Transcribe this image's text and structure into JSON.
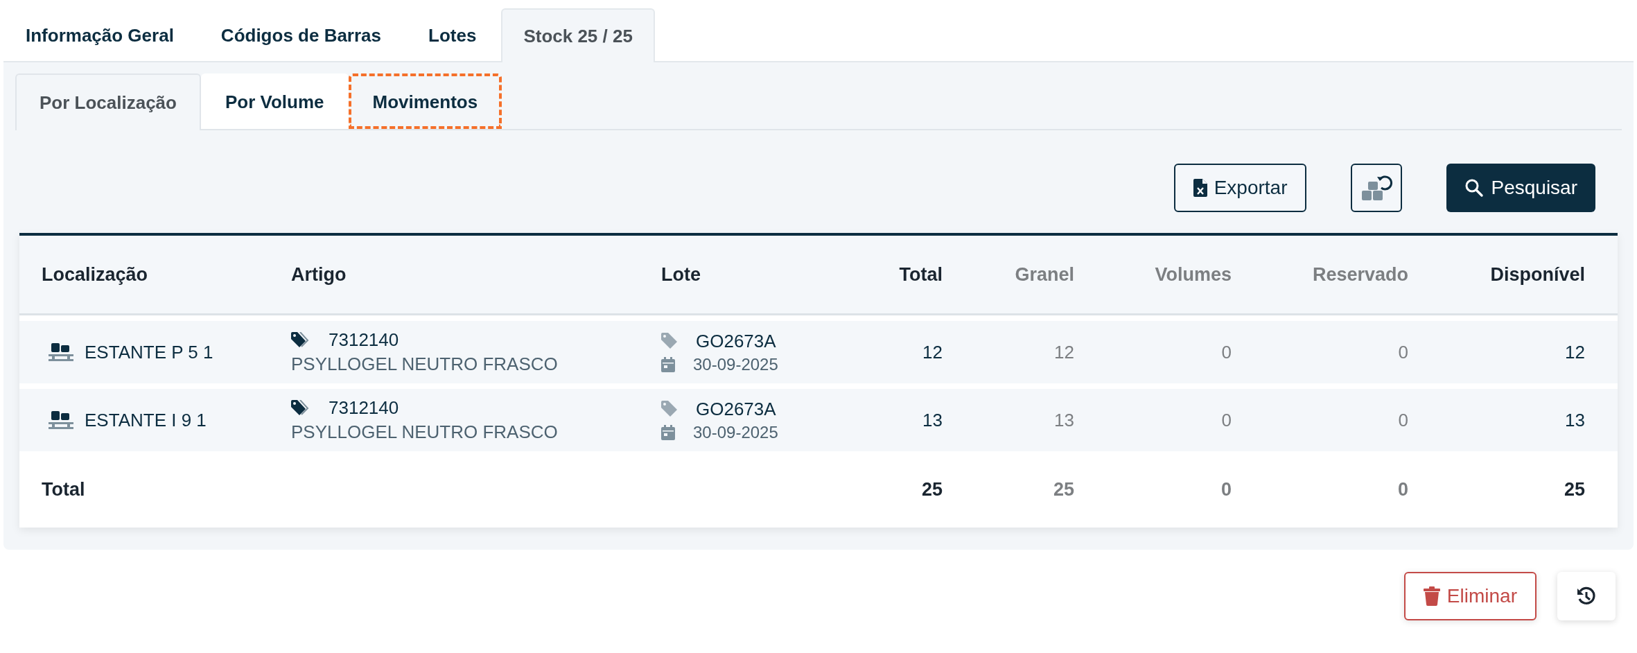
{
  "tabs": [
    {
      "label": "Informação Geral",
      "selected": false
    },
    {
      "label": "Códigos de Barras",
      "selected": false
    },
    {
      "label": "Lotes",
      "selected": false
    },
    {
      "label": "Stock 25 / 25",
      "selected": true
    }
  ],
  "subtabs": [
    {
      "label": "Por Localização",
      "selected": true,
      "highlighted": false
    },
    {
      "label": "Por Volume",
      "selected": false,
      "highlighted": false
    },
    {
      "label": "Movimentos",
      "selected": false,
      "highlighted": true
    }
  ],
  "toolbar": {
    "export_label": "Exportar",
    "search_label": "Pesquisar"
  },
  "table": {
    "columns": [
      {
        "label": "Localização",
        "muted": false
      },
      {
        "label": "Artigo",
        "muted": false
      },
      {
        "label": "Lote",
        "muted": false
      },
      {
        "label": "Total",
        "muted": false
      },
      {
        "label": "Granel",
        "muted": true
      },
      {
        "label": "Volumes",
        "muted": true
      },
      {
        "label": "Reservado",
        "muted": true
      },
      {
        "label": "Disponível",
        "muted": false
      }
    ],
    "rows": [
      {
        "location": "ESTANTE P 5 1",
        "article_code": "7312140",
        "article_name": "PSYLLOGEL NEUTRO FRASCO",
        "lot": "GO2673A",
        "lot_date": "30-09-2025",
        "values": [
          "12",
          "12",
          "0",
          "0",
          "12"
        ]
      },
      {
        "location": "ESTANTE I 9 1",
        "article_code": "7312140",
        "article_name": "PSYLLOGEL NEUTRO FRASCO",
        "lot": "GO2673A",
        "lot_date": "30-09-2025",
        "values": [
          "13",
          "13",
          "0",
          "0",
          "13"
        ]
      }
    ],
    "total": {
      "label": "Total",
      "values": [
        "25",
        "25",
        "0",
        "0",
        "25"
      ]
    }
  },
  "actions": {
    "delete_label": "Eliminar"
  }
}
